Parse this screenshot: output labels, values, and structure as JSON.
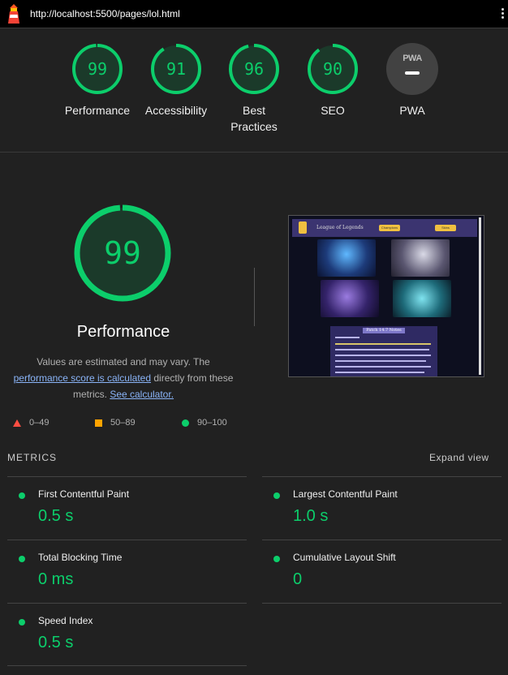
{
  "browser": {
    "url": "http://localhost:5500/pages/lol.html"
  },
  "colors": {
    "pass": "#0cce6b",
    "average": "#ffa400",
    "fail": "#ff4e42",
    "background": "#212121"
  },
  "scores": [
    {
      "label": "Performance",
      "value": "99",
      "fraction": 0.99
    },
    {
      "label": "Accessibility",
      "value": "91",
      "fraction": 0.91
    },
    {
      "label": "Best Practices",
      "value": "96",
      "fraction": 0.96
    },
    {
      "label": "SEO",
      "value": "90",
      "fraction": 0.9
    }
  ],
  "pwa": {
    "badge": "PWA",
    "label": "PWA"
  },
  "main": {
    "score": "99",
    "score_fraction": 0.99,
    "title": "Performance",
    "desc_part1": "Values are estimated and may vary. The",
    "desc_link1": "performance score is calculated",
    "desc_part2": "directly from these metrics.",
    "desc_link2": "See calculator."
  },
  "thumbnail": {
    "site_title": "League of Legends",
    "button1": "Champions",
    "button2": "Skins",
    "notes_title": "Patch 14.7 Notes"
  },
  "legend": [
    {
      "range": "0–49",
      "icon": "triangle-icon"
    },
    {
      "range": "50–89",
      "icon": "square-icon"
    },
    {
      "range": "90–100",
      "icon": "circle-icon"
    }
  ],
  "metrics": {
    "header": "METRICS",
    "expand": "Expand view",
    "items": [
      {
        "label": "First Contentful Paint",
        "value": "0.5 s"
      },
      {
        "label": "Largest Contentful Paint",
        "value": "1.0 s"
      },
      {
        "label": "Total Blocking Time",
        "value": "0 ms"
      },
      {
        "label": "Cumulative Layout Shift",
        "value": "0"
      },
      {
        "label": "Speed Index",
        "value": "0.5 s"
      }
    ]
  }
}
